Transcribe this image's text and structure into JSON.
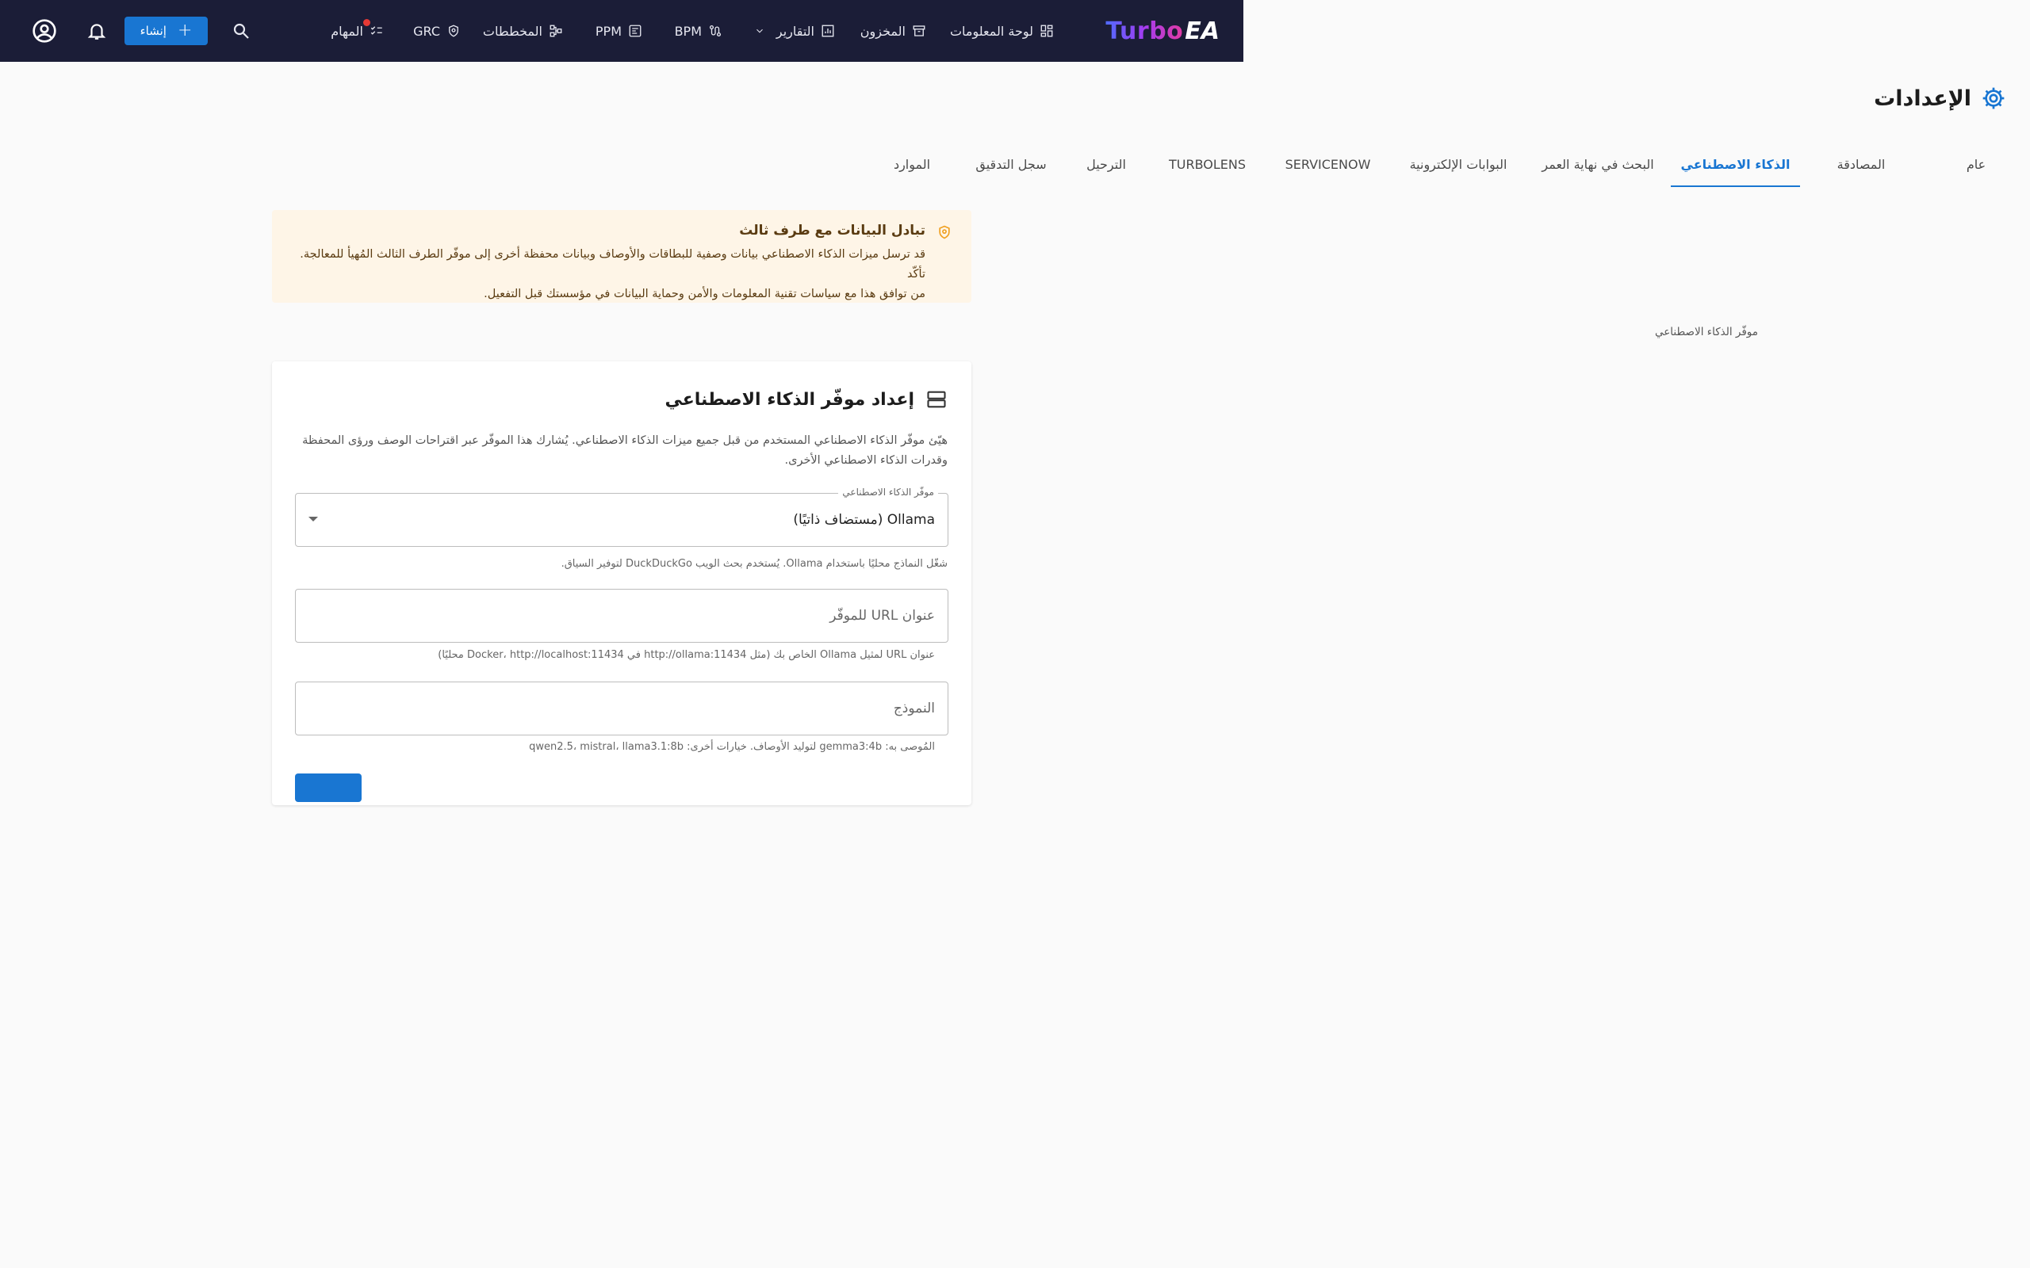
{
  "app": {
    "logo_part1": "Turbo",
    "logo_part2": "EA"
  },
  "nav": {
    "dashboard": "لوحة المعلومات",
    "inventory": "المخزون",
    "reports": "التقارير",
    "bpm": "BPM",
    "ppm": "PPM",
    "diagrams": "المخططات",
    "grc": "GRC",
    "tasks": "المهام",
    "create": "إنشاء"
  },
  "page": {
    "title": "الإعدادات"
  },
  "tabs": [
    {
      "label": "عام",
      "active": false
    },
    {
      "label": "المصادقة",
      "active": false
    },
    {
      "label": "الذكاء الاصطناعي",
      "active": true
    },
    {
      "label": "البحث في نهاية العمر",
      "active": false
    },
    {
      "label": "البوابات الإلكترونية",
      "active": false
    },
    {
      "label": "SERVICENOW",
      "active": false
    },
    {
      "label": "TURBOLENS",
      "active": false
    },
    {
      "label": "الترحيل",
      "active": false
    },
    {
      "label": "سجل التدقيق",
      "active": false
    },
    {
      "label": "الموارد",
      "active": false
    }
  ],
  "warning": {
    "title": "تبادل البيانات مع طرف ثالث",
    "line1": "قد ترسل ميزات الذكاء الاصطناعي بيانات وصفية للبطاقات والأوصاف وبيانات محفظة أخرى إلى موفّر الطرف الثالث المُهيأ للمعالجة. تأكّد",
    "line2": "من توافق هذا مع سياسات تقنية المعلومات والأمن وحماية البيانات في مؤسستك قبل التفعيل."
  },
  "section_label": "موفّر الذكاء الاصطناعي",
  "card": {
    "title": "إعداد موفّر الذكاء الاصطناعي",
    "desc_line1": "هيّئ موفّر الذكاء الاصطناعي المستخدم من قبل جميع ميزات الذكاء الاصطناعي. يُشارك هذا الموفّر عبر اقتراحات الوصف ورؤى المحفظة",
    "desc_line2": "وقدرات الذكاء الاصطناعي الأخرى."
  },
  "provider_field": {
    "label": "موفّر الذكاء الاصطناعي",
    "value": "Ollama (مستضاف ذاتيًا)",
    "helper": "شغّل النماذج محليًا باستخدام Ollama. يُستخدم بحث الويب DuckDuckGo لتوفير السياق."
  },
  "url_field": {
    "placeholder": "عنوان URL للموفّر",
    "helper": "عنوان URL لمثيل Ollama الخاص بك (مثل http://ollama:11434 في Docker، http://localhost:11434 محليًا)"
  },
  "model_field": {
    "placeholder": "النموذج",
    "helper": "المُوصى به: gemma3:4b لتوليد الأوصاف. خيارات أخرى: qwen2.5، mistral، llama3.1:8b"
  },
  "colors": {
    "topbar": "#1b1d37",
    "accent": "#1976d2",
    "warning_bg": "#fef5e7",
    "notification_dot": "#e53935"
  },
  "icons": [
    "dashboard-icon",
    "inventory-icon",
    "reports-icon",
    "chevron-down-icon",
    "bpm-icon",
    "ppm-icon",
    "diagrams-icon",
    "grc-shield-icon",
    "tasks-icon",
    "search-icon",
    "bell-icon",
    "account-icon",
    "gear-icon",
    "shield-warning-icon",
    "server-icon"
  ]
}
